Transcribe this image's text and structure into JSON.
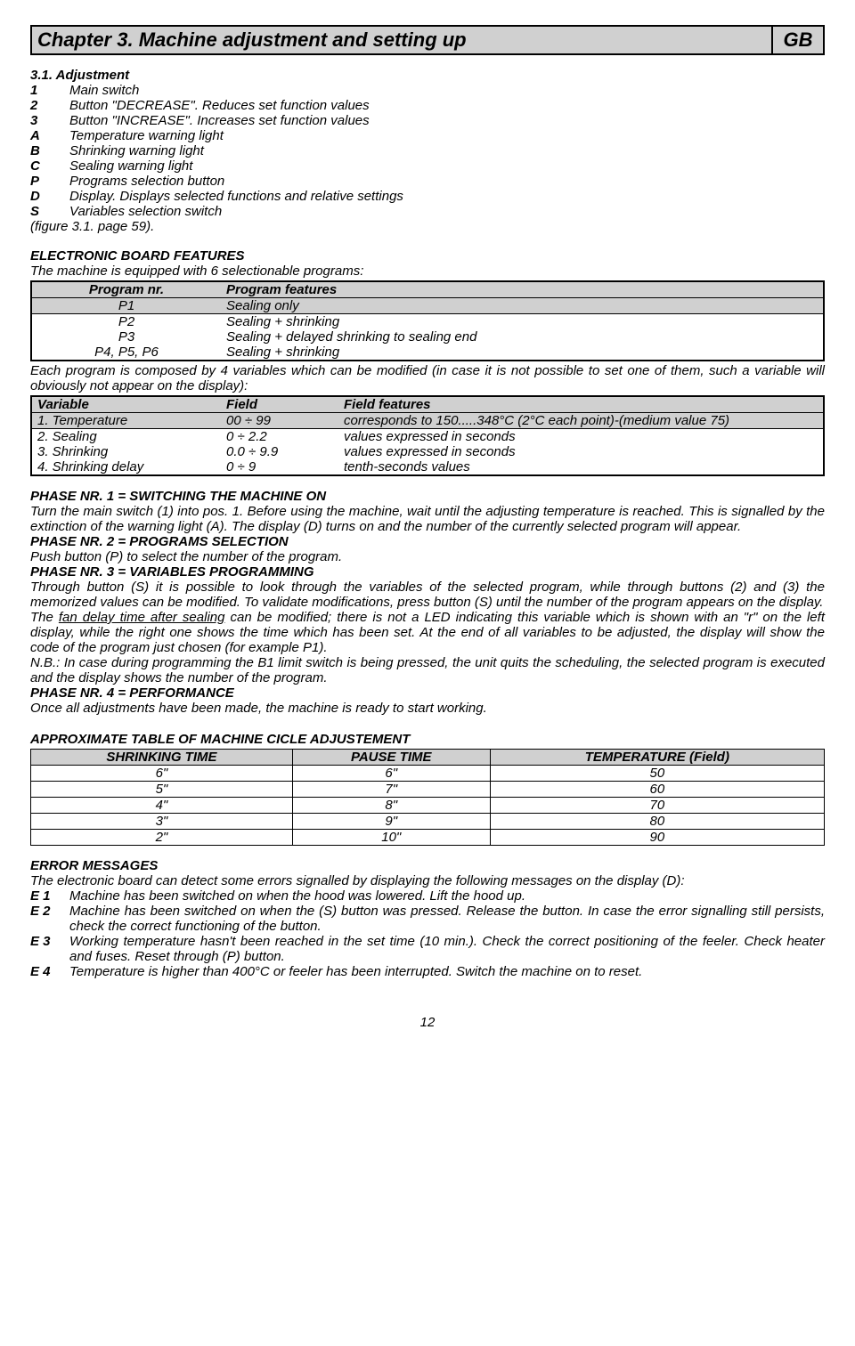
{
  "chapter": {
    "title": "Chapter 3. Machine adjustment and setting up",
    "lang": "GB"
  },
  "adjustment": {
    "heading": "3.1. Adjustment",
    "items": [
      {
        "k": "1",
        "t": "Main switch"
      },
      {
        "k": "2",
        "t": "Button \"DECREASE\". Reduces set function values"
      },
      {
        "k": "3",
        "t": "Button \"INCREASE\". Increases set function values"
      },
      {
        "k": "A",
        "t": "Temperature warning light"
      },
      {
        "k": "B",
        "t": "Shrinking warning light"
      },
      {
        "k": "C",
        "t": "Sealing warning light"
      },
      {
        "k": "P",
        "t": "Programs selection button"
      },
      {
        "k": "D",
        "t": "Display. Displays selected functions and relative settings"
      },
      {
        "k": "S",
        "t": "Variables selection switch"
      }
    ],
    "figure_ref": "(figure 3.1. page 59)."
  },
  "ebf": {
    "heading": "ELECTRONIC BOARD FEATURES",
    "intro": "The machine is equipped with 6 selectionable programs:",
    "tbl_h1": "Program nr.",
    "tbl_h2": "Program features",
    "rows": [
      {
        "p": "P1",
        "f": "Sealing only"
      },
      {
        "p": "P2",
        "f": "Sealing + shrinking"
      },
      {
        "p": "P3",
        "f": "Sealing + delayed shrinking to sealing end"
      },
      {
        "p": "P4, P5, P6",
        "f": "Sealing + shrinking"
      }
    ],
    "note": "Each program is composed by 4 variables which can be modified (in case it is not possible to set one of them, such a variable will obviously not appear on the display):"
  },
  "vars": {
    "h1": "Variable",
    "h2": "Field",
    "h3": "Field features",
    "rows": [
      {
        "v": "1.  Temperature",
        "f": "00 ÷ 99",
        "d": "corresponds to 150.....348°C (2°C each point)-(medium value 75)"
      },
      {
        "v": "2.  Sealing",
        "f": "0 ÷ 2.2",
        "d": "values expressed in seconds"
      },
      {
        "v": "3.  Shrinking",
        "f": "0.0  ÷ 9.9",
        "d": "values expressed in seconds"
      },
      {
        "v": "4.  Shrinking delay",
        "f": "0 ÷ 9",
        "d": "tenth-seconds values"
      }
    ]
  },
  "phases": {
    "p1h": "PHASE NR. 1 = SWITCHING THE MACHINE ON",
    "p1t": "Turn the main switch (1) into pos. 1. Before using the machine, wait until the adjusting temperature is reached. This is signalled by the extinction of the warning light (A). The display (D) turns on and the number of the currently selected program will appear.",
    "p2h": "PHASE NR. 2 = PROGRAMS SELECTION",
    "p2t": "Push button (P) to select the number of the program.",
    "p3h": "PHASE NR. 3 = VARIABLES PROGRAMMING",
    "p3t1": "Through button (S) it is possible to look through the variables of the selected program, while through buttons (2) and (3) the memorized values can be modified. To validate modifications, press button (S) until the number of the program appears on the display.",
    "p3t2a": "The ",
    "p3t2u": "fan delay time after sealing",
    "p3t2b": " can be modified; there is not a LED indicating this variable which is shown with an \"r\" on the left display, while the right one shows the time which has been set. At the end of all variables to be adjusted, the display will show the code of the program just chosen (for example P1).",
    "p3nb": "N.B.: In case during programming the B1 limit switch is being pressed, the unit quits the scheduling, the selected program is executed and the display shows the number of the program.",
    "p4h": "PHASE NR. 4 = PERFORMANCE",
    "p4t": "Once all adjustments have been made, the machine is ready to start working."
  },
  "cycle": {
    "heading": "APPROXIMATE TABLE OF MACHINE CICLE ADJUSTEMENT",
    "h1": "SHRINKING TIME",
    "h2": "PAUSE TIME",
    "h3": "TEMPERATURE (Field)",
    "rows": [
      {
        "a": "6\"",
        "b": "6\"",
        "c": "50"
      },
      {
        "a": "5\"",
        "b": "7\"",
        "c": "60"
      },
      {
        "a": "4\"",
        "b": "8\"",
        "c": "70"
      },
      {
        "a": "3\"",
        "b": "9\"",
        "c": "80"
      },
      {
        "a": "2\"",
        "b": "10\"",
        "c": "90"
      }
    ]
  },
  "chart_data": {
    "type": "table",
    "title": "APPROXIMATE TABLE OF MACHINE CICLE ADJUSTEMENT",
    "columns": [
      "SHRINKING TIME (s)",
      "PAUSE TIME (s)",
      "TEMPERATURE (Field)"
    ],
    "rows": [
      [
        6,
        6,
        50
      ],
      [
        5,
        7,
        60
      ],
      [
        4,
        8,
        70
      ],
      [
        3,
        9,
        80
      ],
      [
        2,
        10,
        90
      ]
    ]
  },
  "errors": {
    "heading": "ERROR MESSAGES",
    "intro": "The electronic board can detect some errors signalled by displaying the following messages on the display (D):",
    "items": [
      {
        "k": "E 1",
        "t": "Machine has been switched on when the hood was lowered. Lift the hood up."
      },
      {
        "k": "E 2",
        "t": "Machine has been switched on when the (S) button was pressed. Release the button. In case the error signalling still persists, check the correct functioning of the button."
      },
      {
        "k": "E 3",
        "t": "Working temperature hasn't been reached in the set time (10 min.). Check the correct positioning of the feeler. Check heater and fuses. Reset through (P) button."
      },
      {
        "k": "E 4",
        "t": "Temperature is higher than 400°C or feeler has been interrupted. Switch the machine on to reset."
      }
    ]
  },
  "page_number": "12"
}
